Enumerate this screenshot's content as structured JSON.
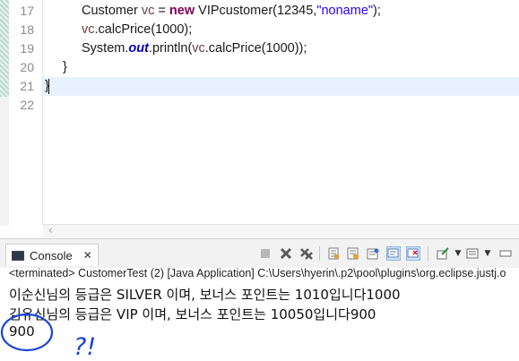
{
  "editor": {
    "line_numbers": [
      "17",
      "18",
      "19",
      "20",
      "21",
      "22"
    ],
    "lines": {
      "l17": {
        "type": "Customer ",
        "var": "vc",
        "eq": " = ",
        "kw": "new",
        "ctor": " VIPcustomer(12345,",
        "str": "\"noname\"",
        "end": ");"
      },
      "l18": {
        "var": "vc",
        "rest": ".calcPrice(1000);"
      },
      "l19": {
        "pre": "System.",
        "field": "out",
        "mid": ".println(",
        "var": "vc",
        "rest": ".calcPrice(1000));"
      },
      "l20": {
        "text": "}"
      },
      "l21": {
        "text": "}"
      }
    }
  },
  "console": {
    "tab_label": "Console",
    "tab_close": "✕",
    "toolbar_icons": [
      "terminate-icon",
      "remove-launch-icon",
      "remove-all-terminated-icon",
      "scroll-lock-icon",
      "word-wrap-icon",
      "show-console-stdout-icon",
      "show-console-stderr-icon",
      "pin-console-icon",
      "display-selected-console-icon",
      "open-console-icon"
    ],
    "terminated_text": "<terminated> CustomerTest (2) [Java Application] C:\\Users\\hyerin\\.p2\\pool\\plugins\\org.eclipse.justj.o",
    "output": [
      "이순신님의 등급은 SILVER 이며, 보너스 포인트는 1010입니다1000",
      "김유신님의 등급은 VIP 이며, 보너스 포인트는 10050입니다900",
      "900"
    ],
    "annotation_text": "?!"
  }
}
